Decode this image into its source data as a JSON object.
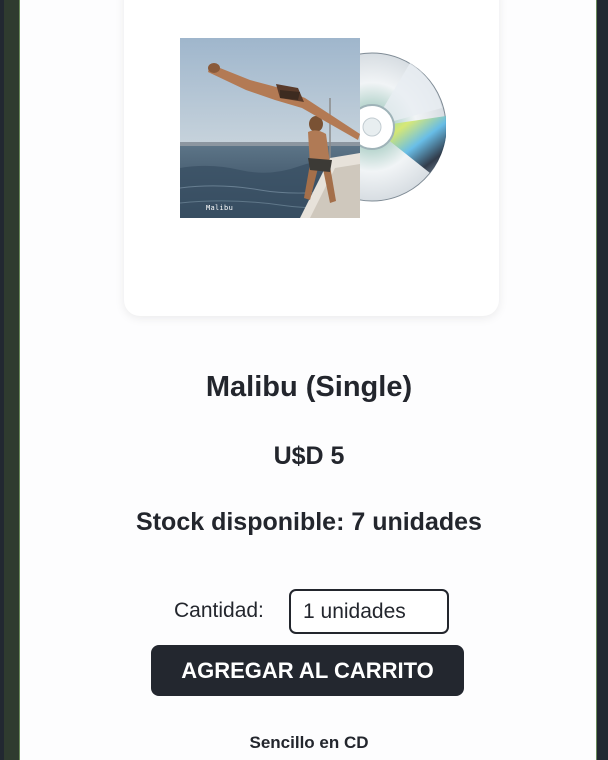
{
  "product": {
    "cover_label": "Malibu",
    "title": "Malibu (Single)",
    "price": "U$D 5",
    "stock": "Stock disponible: 7 unidades",
    "format": "Sencillo en CD"
  },
  "quantity": {
    "label": "Cantidad:",
    "value": "1 unidades"
  },
  "actions": {
    "add_to_cart": "AGREGAR AL CARRITO"
  }
}
